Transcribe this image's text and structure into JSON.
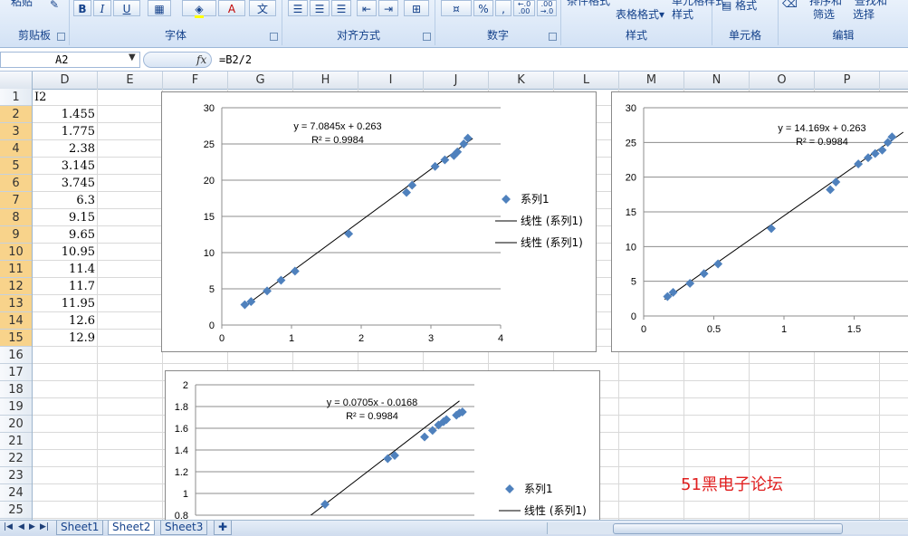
{
  "ribbon": {
    "groups": [
      {
        "label": "剪贴板"
      },
      {
        "label": "字体"
      },
      {
        "label": "对齐方式"
      },
      {
        "label": "数字"
      },
      {
        "label": "样式"
      },
      {
        "label": "单元格"
      },
      {
        "label": "编辑"
      }
    ],
    "paste_label": "粘贴",
    "bold": "B",
    "italic": "I",
    "underline": "U",
    "font_color": "A",
    "wen": "文",
    "percent": "%",
    "comma": ",",
    "inc_decimal": "←.0 .00",
    "dec_decimal": ".00 →.0",
    "cond_format": "条件格式",
    "table_format": "表格格式",
    "table_format_arrow": "▾",
    "cell_style": "单元格样式",
    "cell_style_short": "样式",
    "format_label": "格式",
    "sort_filter": "筛选",
    "find_select": "选择",
    "sort_label": "排序和",
    "find_label": "查找和"
  },
  "formula_bar": {
    "name_box": "A2",
    "fx": "fx",
    "formula": "=B2/2"
  },
  "columns": [
    "D",
    "E",
    "F",
    "G",
    "H",
    "I",
    "J",
    "K",
    "L",
    "M",
    "N",
    "O",
    "P"
  ],
  "rows": [
    "1",
    "2",
    "3",
    "4",
    "5",
    "6",
    "7",
    "8",
    "9",
    "10",
    "11",
    "12",
    "13",
    "14",
    "15",
    "16",
    "17",
    "18",
    "19",
    "20",
    "21",
    "22",
    "23",
    "24",
    "25"
  ],
  "cells": {
    "header": "I2",
    "d_values": [
      "1.455",
      "1.775",
      "2.38",
      "3.145",
      "3.745",
      "6.3",
      "9.15",
      "9.65",
      "10.95",
      "11.4",
      "11.7",
      "11.95",
      "12.6",
      "12.9"
    ]
  },
  "chart_data": [
    {
      "type": "scatter",
      "y_ticks": [
        "30",
        "25",
        "20",
        "15",
        "10",
        "5",
        "0"
      ],
      "x_ticks": [
        "0",
        "1",
        "2",
        "3",
        "4"
      ],
      "xlim": [
        0,
        4
      ],
      "ylim": [
        0,
        30
      ],
      "points": [
        [
          0.33,
          2.81
        ],
        [
          0.42,
          3.24
        ],
        [
          0.65,
          4.71
        ],
        [
          0.85,
          6.18
        ],
        [
          1.05,
          7.44
        ],
        [
          1.82,
          12.6
        ],
        [
          2.65,
          18.3
        ],
        [
          2.73,
          19.3
        ],
        [
          3.06,
          21.9
        ],
        [
          3.2,
          22.8
        ],
        [
          3.33,
          23.4
        ],
        [
          3.38,
          23.9
        ],
        [
          3.47,
          25.0
        ],
        [
          3.53,
          25.8
        ]
      ],
      "trend": {
        "slope": 7.0845,
        "intercept": 0.263
      },
      "equation": "y = 7.0845x + 0.263",
      "r2": "R² = 0.9984",
      "legend": [
        "系列1",
        "线性 (系列1)",
        "线性 (系列1)"
      ],
      "color": "#4f81bd"
    },
    {
      "type": "scatter",
      "y_ticks": [
        "30",
        "25",
        "20",
        "15",
        "10",
        "5",
        "0"
      ],
      "x_ticks": [
        "0",
        "0.5",
        "1",
        "1.5"
      ],
      "xlim": [
        0,
        2
      ],
      "ylim": [
        0,
        30
      ],
      "points": [
        [
          0.17,
          2.8
        ],
        [
          0.21,
          3.4
        ],
        [
          0.33,
          4.7
        ],
        [
          0.43,
          6.1
        ],
        [
          0.53,
          7.5
        ],
        [
          0.91,
          12.6
        ],
        [
          1.33,
          18.2
        ],
        [
          1.37,
          19.3
        ],
        [
          1.53,
          21.9
        ],
        [
          1.6,
          22.8
        ],
        [
          1.65,
          23.4
        ],
        [
          1.7,
          23.9
        ],
        [
          1.74,
          25.0
        ],
        [
          1.77,
          25.8
        ]
      ],
      "trend": {
        "slope": 14.169,
        "intercept": 0.263
      },
      "equation": "y = 14.169x + 0.263",
      "r2": "R² = 0.9984",
      "color": "#4f81bd"
    },
    {
      "type": "scatter",
      "y_ticks": [
        "2",
        "1.8",
        "1.6",
        "1.4",
        "1.2",
        "1",
        "0.8"
      ],
      "x_ticks": [],
      "ylim": [
        0.8,
        2.0
      ],
      "points": [
        [
          13.0,
          0.9
        ],
        [
          19.3,
          1.32
        ],
        [
          20.0,
          1.35
        ],
        [
          23.0,
          1.52
        ],
        [
          23.8,
          1.58
        ],
        [
          24.4,
          1.63
        ],
        [
          24.9,
          1.66
        ],
        [
          25.2,
          1.68
        ],
        [
          26.2,
          1.72
        ],
        [
          26.5,
          1.74
        ],
        [
          26.8,
          1.75
        ]
      ],
      "xlim": [
        0,
        28
      ],
      "trend": {
        "slope": 0.0705,
        "intercept": -0.0168
      },
      "equation": "y = 0.0705x - 0.0168",
      "r2": "R² = 0.9984",
      "legend": [
        "系列1",
        "线性 (系列1)"
      ],
      "color": "#4f81bd"
    }
  ],
  "watermark": "51黑电子论坛",
  "sheets": [
    "Sheet1",
    "Sheet2",
    "Sheet3"
  ],
  "nav_glyphs": [
    "|◀",
    "◀",
    "▶",
    "▶|"
  ]
}
